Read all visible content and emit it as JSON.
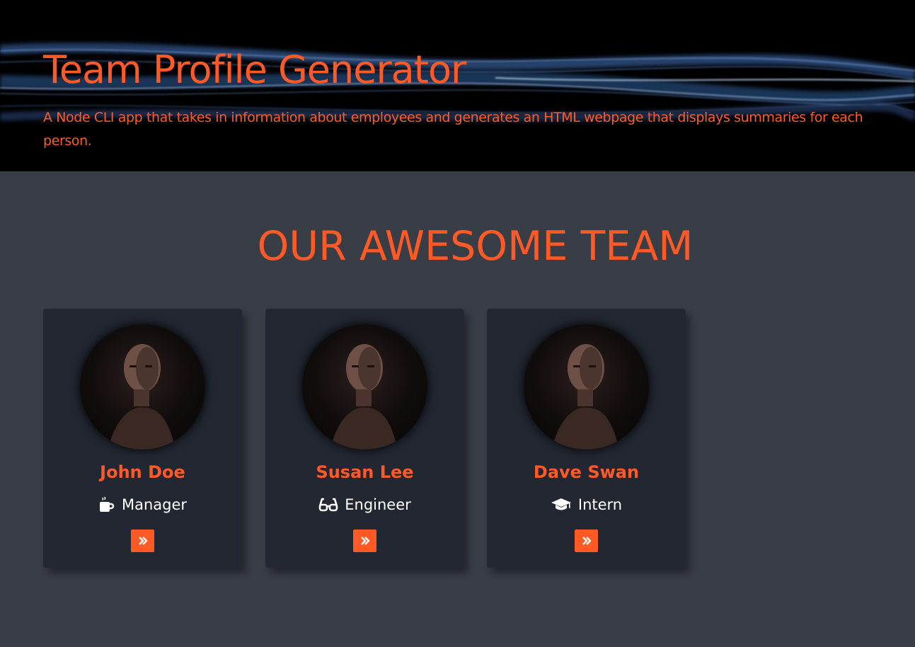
{
  "header": {
    "title": "Team Profile Generator",
    "subtitle": "A Node CLI app that takes in information about employees and generates an HTML webpage that displays summaries for each person."
  },
  "team": {
    "heading": "OUR AWESOME TEAM",
    "members": [
      {
        "name": "John Doe",
        "role": "Manager",
        "icon": "coffee-mug-icon"
      },
      {
        "name": "Susan Lee",
        "role": "Engineer",
        "icon": "glasses-icon"
      },
      {
        "name": "Dave Swan",
        "role": "Intern",
        "icon": "graduation-cap-icon"
      }
    ]
  },
  "colors": {
    "accent": "#ff5a26",
    "page_background": "#393d46",
    "card_background": "#222732",
    "hero_background": "#000000"
  }
}
